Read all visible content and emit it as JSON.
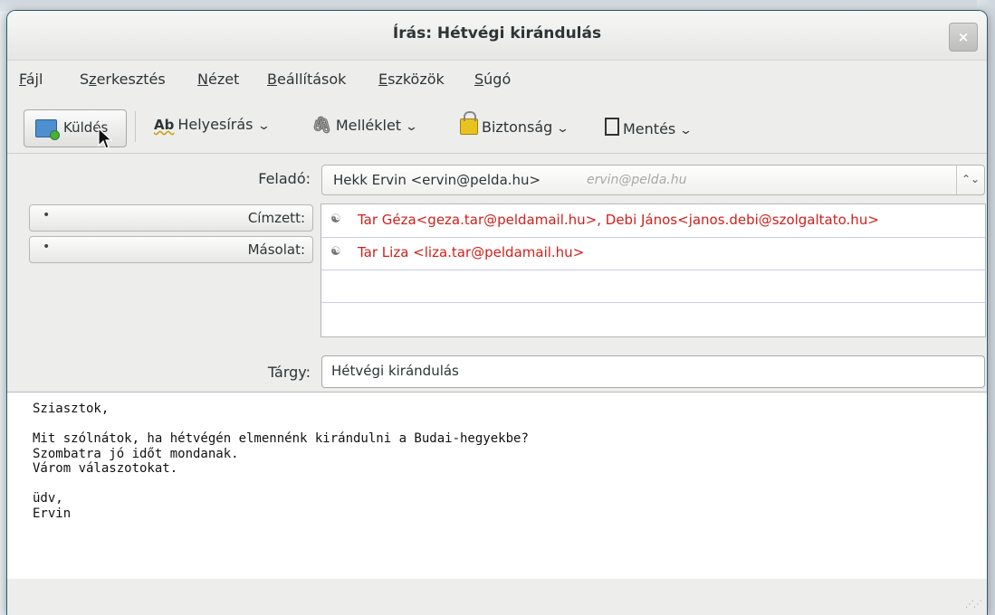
{
  "window": {
    "title": "Írás: Hétvégi kirándulás",
    "close_glyph": "×"
  },
  "menu": [
    {
      "label": "Fájl",
      "accel_index": 0
    },
    {
      "label": "Szerkesztés",
      "accel_index": 1
    },
    {
      "label": "Nézet",
      "accel_index": 0
    },
    {
      "label": "Beállítások",
      "accel_index": 0
    },
    {
      "label": "Eszközök",
      "accel_index": 0
    },
    {
      "label": "Súgó",
      "accel_index": 0
    }
  ],
  "toolbar": {
    "send_label": "Küldés",
    "spell_icon_text": "Ab",
    "spell_label": "Helyesírás",
    "attach_label": "Melléklet",
    "security_label": "Biztonság",
    "save_label": "Mentés",
    "dropdown_glyph": "⌄"
  },
  "header": {
    "from_label": "Feladó:",
    "from_value": "Hekk Ervin <ervin@pelda.hu>",
    "from_hint": "ervin@pelda.hu",
    "to_label": "Címzett:",
    "cc_label": "Másolat:",
    "recipients": [
      "Tar Géza<geza.tar@peldamail.hu>, Debi János<janos.debi@szolgaltato.hu>",
      "Tar Liza <liza.tar@peldamail.hu>"
    ],
    "subject_label": "Tárgy:",
    "subject_value": "Hétvégi kirándulás"
  },
  "body": {
    "text": "Sziasztok,\n\nMit szólnátok, ha hétvégén elmennénk kirándulni a Budai-hegyekbe?\nSzombatra jó időt mondanak.\nVárom válaszotokat.\n\nüdv,\nErvin"
  },
  "colors": {
    "recipient_text": "#d0201c",
    "window_bg": "#ededec"
  }
}
